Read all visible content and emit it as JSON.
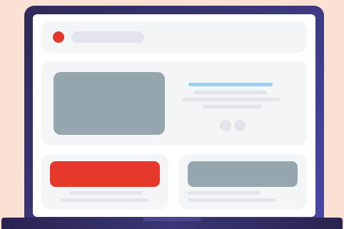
{
  "illustration": {
    "colors": {
      "background": "#fbe0d4",
      "laptop_frame": "#3e3a84",
      "accent_red": "#e5382a",
      "placeholder_gray": "#96a6af",
      "skeleton_line": "#e2e5ec",
      "accent_blue": "#9ed0f0",
      "card_background": "#f4f5f7"
    }
  }
}
